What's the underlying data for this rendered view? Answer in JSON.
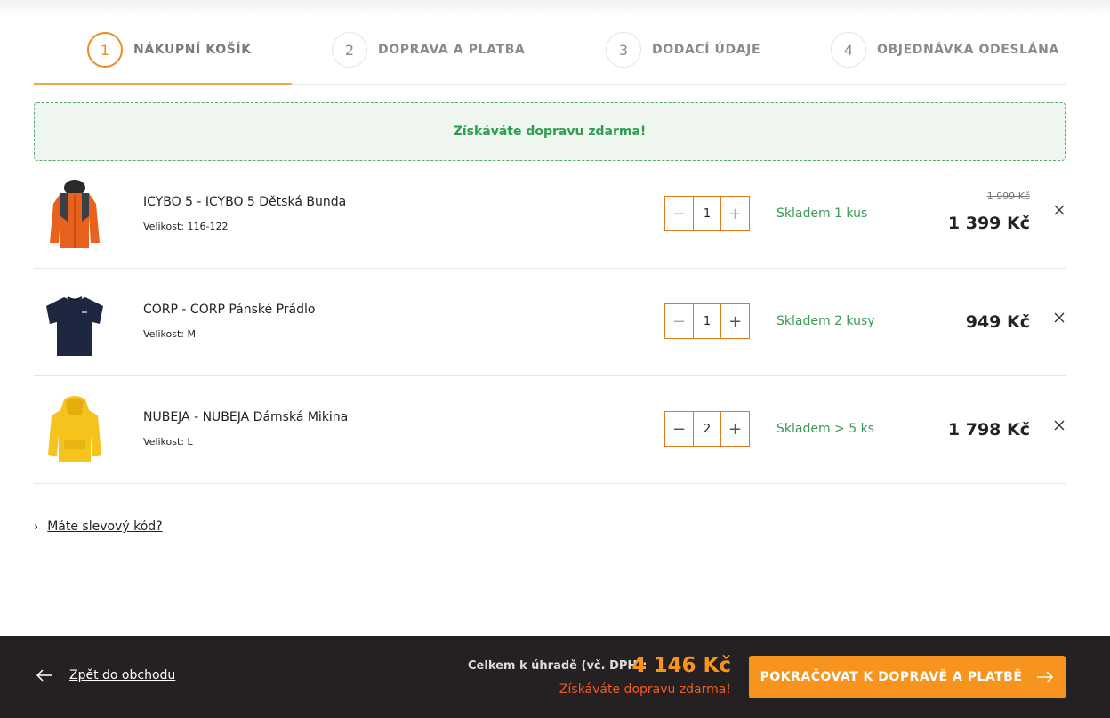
{
  "steps": [
    {
      "num": "1",
      "label": "NÁKUPNÍ KOŠÍK"
    },
    {
      "num": "2",
      "label": "DOPRAVA A PLATBA"
    },
    {
      "num": "3",
      "label": "DODACÍ ÚDAJE"
    },
    {
      "num": "4",
      "label": "OBJEDNÁVKA ODESLÁNA"
    }
  ],
  "banner": {
    "text": "Získáváte dopravu zdarma!"
  },
  "items": [
    {
      "name": "ICYBO 5 - ICYBO 5 Dětská Bunda",
      "size": "Velikost: 116-122",
      "qty": "1",
      "stock": "Skladem 1 kus",
      "old_price": "1 999 Kč",
      "price": "1 399 Kč",
      "icon": "jacket-image"
    },
    {
      "name": "CORP - CORP Pánské Prádlo",
      "size": "Velikost: M",
      "qty": "1",
      "stock": "Skladem 2 kusy",
      "price": "949 Kč",
      "icon": "tshirt-image"
    },
    {
      "name": "NUBEJA - NUBEJA Dámská Mikina",
      "size": "Velikost: L",
      "qty": "2",
      "stock": "Skladem > 5 ks",
      "price": "1 798 Kč",
      "icon": "hoodie-image"
    }
  ],
  "discount": {
    "chevron": "›",
    "label": "Máte slevový kód?"
  },
  "footer": {
    "back_label": "Zpět do obchodu",
    "total_label": "Celkem k úhradě (vč. DPH):",
    "total_value": "4 146 Kč",
    "total_note": "Získáváte dopravu zdarma!",
    "cta_label": "POKRAČOVAT K DOPRAVĚ A PLATBĚ"
  },
  "colors": {
    "accent": "#f7941d",
    "stock_green": "#3a9a56",
    "footer_bg": "#252122"
  }
}
